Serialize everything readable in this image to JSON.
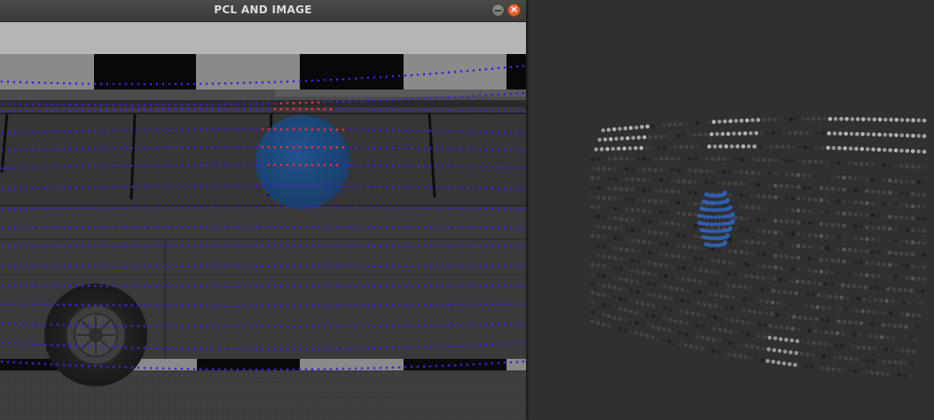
{
  "window": {
    "title": "PCL AND IMAGE",
    "controls": {
      "minimize_glyph": "–",
      "close_glyph": "×"
    },
    "close_color": "#e95420"
  },
  "scene": {
    "description_icons": [
      "bus-icon",
      "wheel-icon",
      "sphere-icon"
    ],
    "colors": {
      "sky": "#b5b5b5",
      "ground": "#3c3c3c",
      "bus_body": "#3a393b",
      "checker_dark": "#0b0b0b",
      "checker_light": "#8c8c8c",
      "sphere": "#1c4d8c",
      "lidar_points": "#4a1bd6",
      "highlight_points": "#ff2a3c"
    }
  },
  "viewer": {
    "colors": {
      "background": "#303030",
      "points_dark": "#1a1a1a",
      "points_light": "#a0a0a0",
      "sphere_points": "#2f5fb3"
    }
  }
}
